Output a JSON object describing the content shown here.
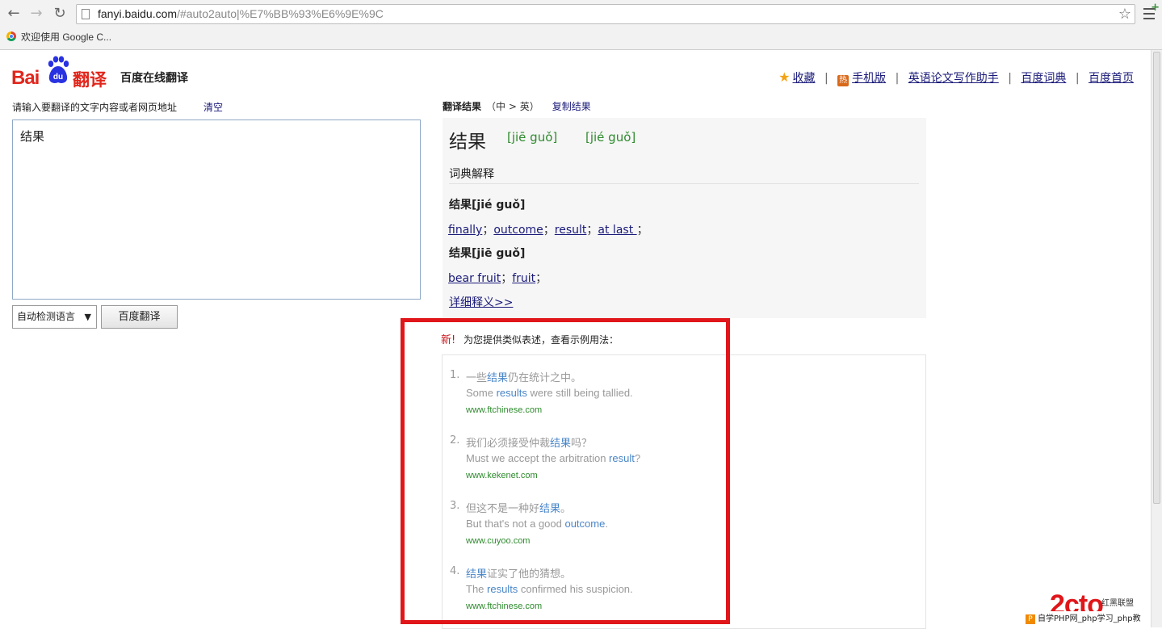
{
  "browser": {
    "url_host": "fanyi.baidu.com",
    "url_path": "/#auto2auto|%E7%BB%93%E6%9E%9C",
    "bookmark_label": "欢迎使用 Google C..."
  },
  "header": {
    "logo_bai": "Bai",
    "logo_du": "du",
    "logo_fanyi": "翻译",
    "site_title": "百度在线翻译",
    "links": [
      "收藏",
      "手机版",
      "英语论文写作助手",
      "百度词典",
      "百度首页"
    ],
    "separator": "|"
  },
  "input": {
    "label": "请输入要翻译的文字内容或者网页地址",
    "clear": "清空",
    "text": "结果",
    "language": "自动检测语言",
    "translate_button": "百度翻译"
  },
  "result": {
    "label": "翻译结果",
    "direction": "（中 > 英）",
    "copy": "复制结果",
    "word": "结果",
    "pinyin": [
      "[jiē guǒ]",
      "[jié guǒ]"
    ],
    "dict_title": "词典解释",
    "entries": [
      {
        "head": "结果[jié guǒ]",
        "meanings": [
          "finally",
          "outcome",
          "result",
          "at last "
        ]
      },
      {
        "head": "结果[jiē guǒ]",
        "meanings": [
          "bear fruit",
          "fruit"
        ]
      }
    ],
    "separator": "；",
    "more": "详细释义>>"
  },
  "examples": {
    "new_tag": "新!",
    "title": "为您提供类似表述，查看示例用法：",
    "items": [
      {
        "num": "1.",
        "zh_pre": "一些",
        "zh_hl": "结果",
        "zh_post": "仍在统计之中。",
        "en_pre": "Some ",
        "en_hl": "results",
        "en_post": " were still being tallied.",
        "source": "www.ftchinese.com"
      },
      {
        "num": "2.",
        "zh_pre": "我们必须接受仲裁",
        "zh_hl": "结果",
        "zh_post": "吗？",
        "en_pre": "Must we accept the arbitration ",
        "en_hl": "result",
        "en_post": "?",
        "source": "www.kekenet.com"
      },
      {
        "num": "3.",
        "zh_pre": "但这不是一种好",
        "zh_hl": "结果",
        "zh_post": "。",
        "en_pre": "But that's not a good ",
        "en_hl": "outcome",
        "en_post": ".",
        "source": "www.cuyoo.com"
      },
      {
        "num": "4.",
        "zh_pre": "",
        "zh_hl": "结果",
        "zh_post": "证实了他的猜想。",
        "en_pre": "The ",
        "en_hl": "results",
        "en_post": " confirmed his suspicion.",
        "source": "www.ftchinese.com"
      }
    ]
  },
  "watermark": {
    "big": "2cto",
    "small": "红黑联盟",
    "bottom": "自学PHP网_php学习_php教"
  },
  "colors": {
    "baidu_red": "#e1261c",
    "link": "#1a1a7a",
    "pinyin_green": "#2e8b2e",
    "highlight_blue": "#4a86c8",
    "frame_red": "#e0161a"
  }
}
